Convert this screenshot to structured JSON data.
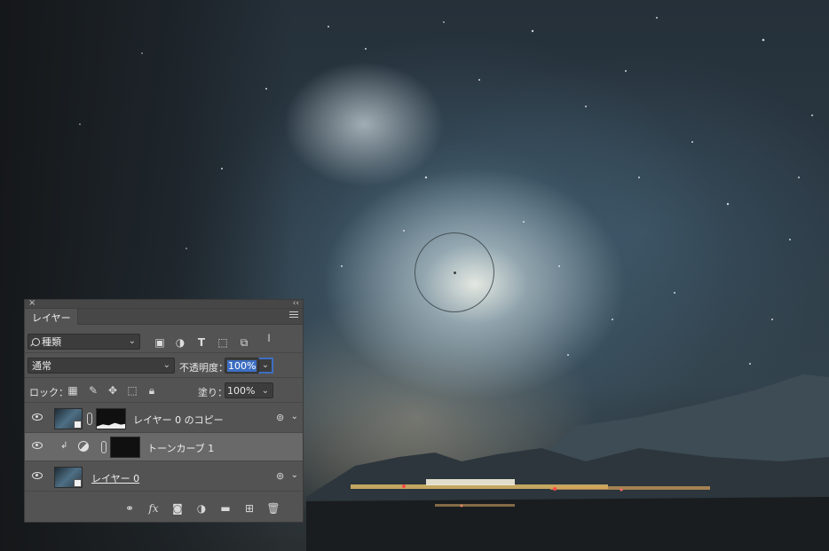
{
  "panel": {
    "close_glyph": "×",
    "collapse_glyph": "‹‹",
    "tab_label": "レイヤー",
    "filter": {
      "kind_label": "種類",
      "icons": [
        "image-filter-icon",
        "adjustment-filter-icon",
        "type-filter-icon",
        "shape-filter-icon",
        "smart-object-filter-icon",
        "filter-toggle-icon"
      ]
    },
    "blend": {
      "mode": "通常",
      "opacity_label": "不透明度：",
      "opacity_value": "100%"
    },
    "lock": {
      "label": "ロック：",
      "fill_label": "塗り：",
      "fill_value": "100%"
    },
    "layers": [
      {
        "name": "レイヤー 0 のコピー",
        "visible": true,
        "selected": false
      },
      {
        "name": "トーンカーブ 1",
        "visible": true,
        "selected": true
      },
      {
        "name": "レイヤー 0",
        "visible": true,
        "selected": false
      }
    ],
    "bottom_icons": [
      "link-layers-icon",
      "fx-icon",
      "add-mask-icon",
      "new-adjustment-icon",
      "new-group-icon",
      "new-layer-icon",
      "delete-layer-icon"
    ]
  },
  "colors": {
    "panel_bg": "#535353",
    "selected_row": "#696969",
    "accent": "#3d6fc3"
  }
}
